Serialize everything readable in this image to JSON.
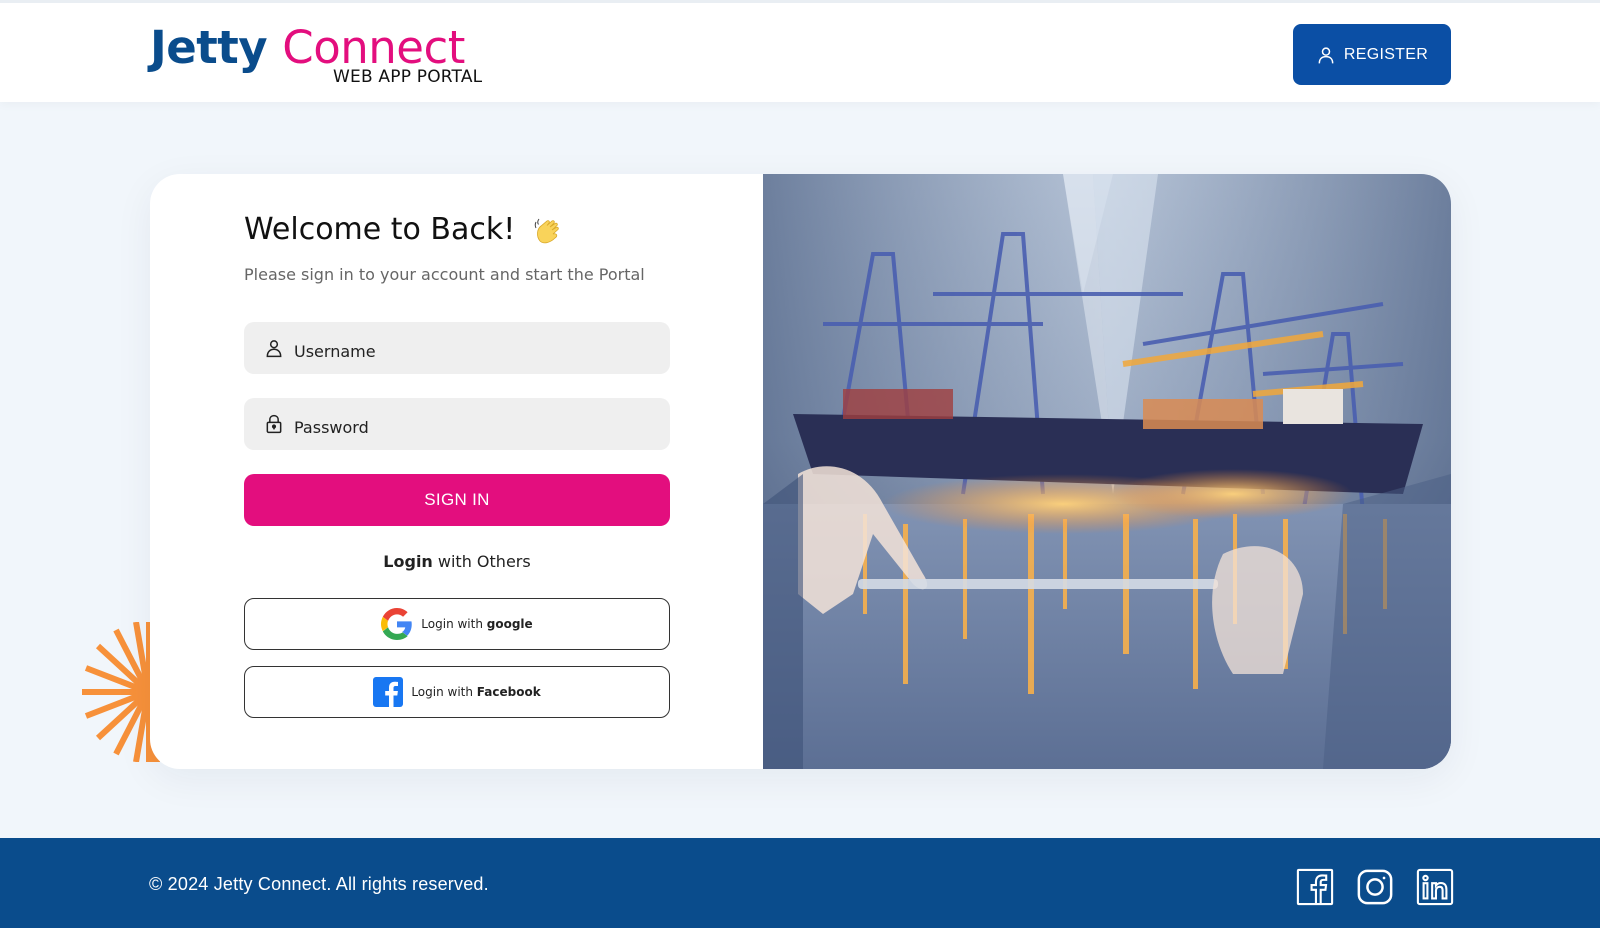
{
  "header": {
    "logo": {
      "word1": "Jetty",
      "word2": "Connect",
      "subtitle": "WEB APP PORTAL"
    },
    "register_label": "REGISTER"
  },
  "login": {
    "title": "Welcome to Back!",
    "subtitle": "Please sign in to your account and start the Portal",
    "username_placeholder": "Username",
    "password_placeholder": "Password",
    "signin_label": "SIGN IN",
    "others_bold": "Login",
    "others_rest": " with Others",
    "google_prefix": "Login with ",
    "google_bold": "google",
    "facebook_prefix": "Login with ",
    "facebook_bold": "Facebook"
  },
  "footer": {
    "copyright": "© 2024 Jetty Connect. All rights reserved.",
    "social": [
      "facebook-icon",
      "instagram-icon",
      "linkedin-icon"
    ]
  },
  "colors": {
    "brand_blue": "#0a4c8c",
    "brand_pink": "#e30e7e",
    "register_blue": "#0b4fa5",
    "background": "#f1f6fb",
    "accent_orange": "#f7913a"
  }
}
